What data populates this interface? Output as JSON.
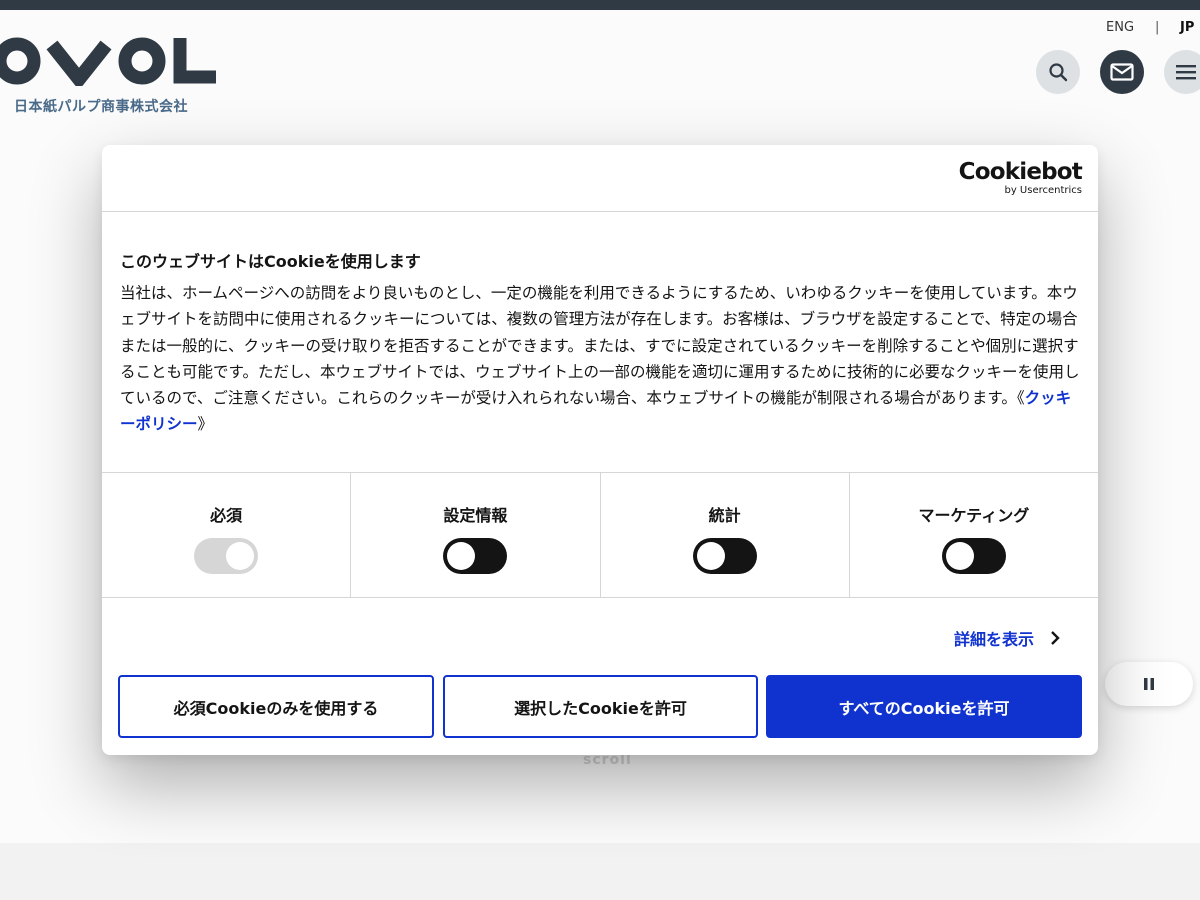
{
  "header": {
    "logo_text": "OVOL",
    "logo_subtitle": "日本紙パルプ商事株式会社",
    "lang_eng": "ENG",
    "lang_separator": "|",
    "lang_jp": "JP"
  },
  "background": {
    "scroll_hint": "scroll"
  },
  "cookie_dialog": {
    "brand_main": "Cookiebot",
    "brand_sub": "by Usercentrics",
    "title": "このウェブサイトはCookieを使用します",
    "body": "当社は、ホームページへの訪問をより良いものとし、一定の機能を利用できるようにするため、いわゆるクッキーを使用しています。本ウェブサイトを訪問中に使用されるクッキーについては、複数の管理方法が存在します。お客様は、ブラウザを設定することで、特定の場合または一般的に、クッキーの受け取りを拒否することができます。または、すでに設定されているクッキーを削除することや個別に選択することも可能です。ただし、本ウェブサイトでは、ウェブサイト上の一部の機能を適切に運用するために技術的に必要なクッキーを使用しているので、ご注意ください。これらのクッキーが受け入れられない場合、本ウェブサイトの機能が制限される場合があります。",
    "policy_open": "《",
    "policy_link": "クッキーポリシー",
    "policy_close": "》",
    "toggles": [
      {
        "label": "必須",
        "state": "on",
        "disabled": true
      },
      {
        "label": "設定情報",
        "state": "off",
        "disabled": false
      },
      {
        "label": "統計",
        "state": "off",
        "disabled": false
      },
      {
        "label": "マーケティング",
        "state": "off",
        "disabled": false
      }
    ],
    "details_label": "詳細を表示",
    "buttons": {
      "necessary_only": "必須Cookieのみを使用する",
      "allow_selection": "選択したCookieを許可",
      "allow_all": "すべてのCookieを許可"
    }
  },
  "colors": {
    "accent": "#1032cf",
    "header_dark": "#2f3a44",
    "logo_subtitle": "#4a6a8a"
  },
  "icons": [
    "search-icon",
    "mail-icon",
    "hamburger-menu-icon",
    "chevron-right-icon",
    "pause-icon"
  ]
}
